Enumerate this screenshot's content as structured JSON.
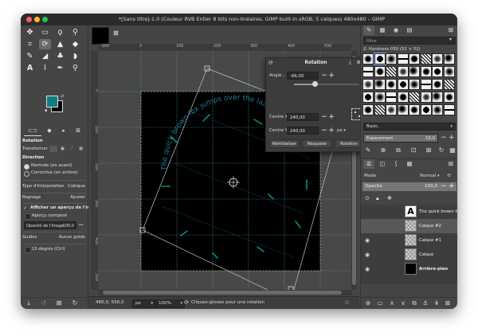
{
  "window": {
    "title": "*[Sans titre]-1.0 (Couleur RVB Entier 8 bits non-linéaires, GIMP built-in sRGB, 5 calques) 480x480 – GIMP"
  },
  "toolbox": {
    "tool_icons": [
      "move-icon",
      "rect-select-icon",
      "lasso-icon",
      "fuzzy-select-icon",
      "crop-icon",
      "unified-transform-icon",
      "warp-icon",
      "bucket-fill-icon",
      "paintbrush-icon",
      "eraser-icon",
      "clone-icon",
      "smudge-icon",
      "text-icon",
      "path-icon",
      "color-picker-icon",
      "zoom-icon"
    ],
    "selected_tool": "rotate-tool",
    "colors": {
      "foreground": "#0d7f80",
      "background": "#000000"
    },
    "options": {
      "tool_name": "Rotation",
      "transform_label": "Transformer :",
      "direction_label": "Direction",
      "direction_normal": "Normale (en avant)",
      "direction_corrective": "Corrective (en arrière)",
      "interpolation_label": "Type d'interpolation",
      "interpolation_value": "Cubique",
      "clipping_label": "Rognage",
      "clipping_value": "Ajuster",
      "show_preview": "Afficher un aperçu de l'image",
      "composited_preview": "Aperçu composé",
      "image_opacity": "Opacité de l'image",
      "image_opacity_value": "100,0",
      "guides_label": "Guides",
      "guides_value": "Aucun guide",
      "constraint": "15 degrés (Ctrl)"
    }
  },
  "canvas": {
    "ruler_ticks": [
      "-100",
      "0",
      "100",
      "200",
      "300",
      "400",
      "500"
    ],
    "ruler_v_ticks": [
      "0",
      "100",
      "200",
      "300",
      "400",
      "500"
    ],
    "text_layer_content": "The quick brown fox jumps over the lazy dog"
  },
  "rotation_dialog": {
    "title": "Rotation",
    "angle_label": "Angle :",
    "angle_value": "-66,00",
    "angle_fraction": 0.32,
    "center_x_label": "Centre X :",
    "center_x_value": "240,00",
    "center_y_label": "Centre Y :",
    "center_y_value": "240,00",
    "unit": "px",
    "reset_button": "Réinitialiser",
    "readjust_button": "Réajuster",
    "rotate_button": "Rotation"
  },
  "statusbar": {
    "coordinates": "480,0, 556,0",
    "unit": "px",
    "zoom": "100%",
    "message": "Cliquez-glissez pour une rotation"
  },
  "dock": {
    "filter_placeholder": "filtre",
    "brush_name": "2. Hardness 050 (51 × 51)",
    "brush_preset": "Basic,",
    "spacing_label": "Espacement",
    "spacing_value": "10,0",
    "mode_label": "Mode",
    "mode_value": "Normal",
    "opacity_label": "Opacité",
    "opacity_value": "100,0",
    "layers": [
      {
        "name": "The quick brown fox jumps over the lazy dog",
        "visible": false,
        "type": "text"
      },
      {
        "name": "Calque #2",
        "visible": false,
        "type": "checker",
        "selected": true
      },
      {
        "name": "Calque #1",
        "visible": true,
        "type": "checker"
      },
      {
        "name": "Calque",
        "visible": true,
        "type": "checker"
      },
      {
        "name": "Arrière-plan",
        "visible": true,
        "type": "black"
      }
    ]
  }
}
